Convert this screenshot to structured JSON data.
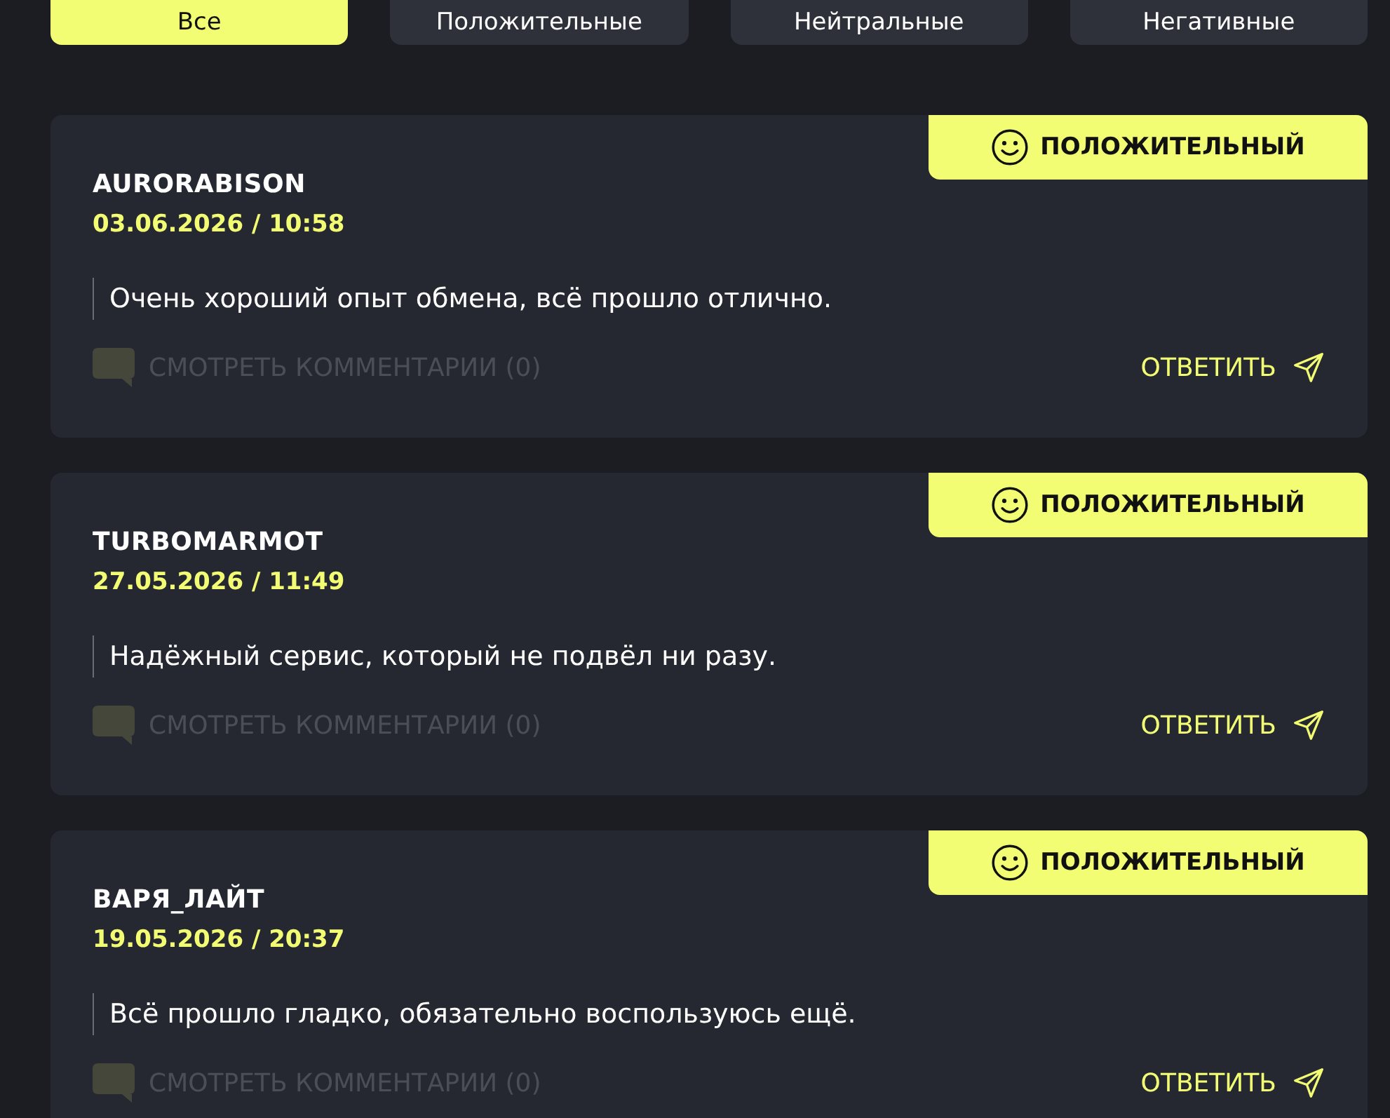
{
  "filter_tabs": [
    {
      "label": "Все",
      "selected": true
    },
    {
      "label": "Положительные",
      "selected": false
    },
    {
      "label": "Нейтральные",
      "selected": false
    },
    {
      "label": "Негативные",
      "selected": false
    }
  ],
  "reviews": [
    {
      "sentiment": {
        "kind": "positive",
        "label": "ПОЛОЖИТЕЛЬНЫЙ"
      },
      "author": "AURORABISON",
      "date": "03.06.2026 / 10:58",
      "text": "Очень хороший опыт обмена, всё прошло отлично.",
      "comments_link": {
        "label": "СМОТРЕТЬ КОММЕНТАРИИ (0)",
        "disabled": true
      },
      "reply_button": "ОТВЕТИТЬ"
    },
    {
      "sentiment": {
        "kind": "positive",
        "label": "ПОЛОЖИТЕЛЬНЫЙ"
      },
      "author": "TURBOMARMOT",
      "date": "27.05.2026 / 11:49",
      "text": "Надёжный сервис, который не подвёл ни разу.",
      "comments_link": {
        "label": "СМОТРЕТЬ КОММЕНТАРИИ (0)",
        "disabled": true
      },
      "reply_button": "ОТВЕТИТЬ"
    },
    {
      "sentiment": {
        "kind": "positive",
        "label": "ПОЛОЖИТЕЛЬНЫЙ"
      },
      "author": "ВАРЯ_ЛАЙТ",
      "date": "19.05.2026 / 20:37",
      "text": "Всё прошло гладко, обязательно воспользуюсь ещё.",
      "comments_link": {
        "label": "СМОТРЕТЬ КОММЕНТАРИИ (0)",
        "disabled": true
      },
      "reply_button": "ОТВЕТИТЬ"
    }
  ]
}
